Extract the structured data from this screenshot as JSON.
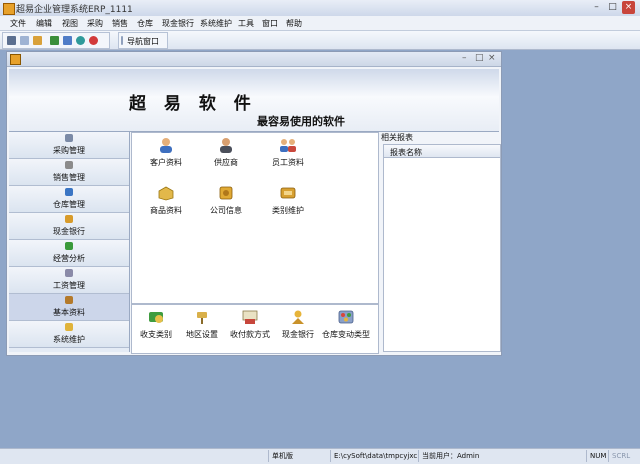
{
  "window": {
    "title": "超易企业管理系统ERP_1111"
  },
  "menu": [
    "文件",
    "编辑",
    "视图",
    "采购",
    "销售",
    "仓库",
    "现金银行",
    "系统维护",
    "工具",
    "窗口",
    "帮助"
  ],
  "toolbar": {
    "nav_window": "导航窗口"
  },
  "banner": {
    "main": "超 易 软 件",
    "sub": "最容易使用的软件"
  },
  "sidebar": {
    "items": [
      {
        "label": "采购管理",
        "icon": "purchase-icon",
        "color": "#7b8aa6"
      },
      {
        "label": "销售管理",
        "icon": "sales-icon",
        "color": "#8b8b8b"
      },
      {
        "label": "仓库管理",
        "icon": "warehouse-icon",
        "color": "#3a75c4"
      },
      {
        "label": "现金银行",
        "icon": "cash-bank-icon",
        "color": "#d89b2a"
      },
      {
        "label": "经营分析",
        "icon": "analysis-icon",
        "color": "#3a9a3a"
      },
      {
        "label": "工资管理",
        "icon": "salary-icon",
        "color": "#8a8aa8"
      },
      {
        "label": "基本资料",
        "icon": "basic-data-icon",
        "color": "#b47a2a"
      },
      {
        "label": "系统维护",
        "icon": "system-maintenance-icon",
        "color": "#e0b33a"
      }
    ],
    "active_index": 6
  },
  "content": {
    "top_icons": [
      {
        "label": "客户资料",
        "icon": "customer-icon"
      },
      {
        "label": "供应商",
        "icon": "supplier-icon"
      },
      {
        "label": "员工资料",
        "icon": "employee-icon"
      },
      {
        "label": "商品资料",
        "icon": "product-icon"
      },
      {
        "label": "公司信息",
        "icon": "company-info-icon"
      },
      {
        "label": "类别维护",
        "icon": "category-icon"
      }
    ],
    "bottom_icons": [
      {
        "label": "收支类别",
        "icon": "income-expense-icon"
      },
      {
        "label": "地区设置",
        "icon": "region-icon"
      },
      {
        "label": "收付款方式",
        "icon": "payment-method-icon"
      },
      {
        "label": "现金银行",
        "icon": "cash-bank-icon"
      },
      {
        "label": "仓库变动类型",
        "icon": "warehouse-change-icon"
      }
    ]
  },
  "right_panel": {
    "title": "相关报表",
    "column": "报表名称"
  },
  "statusbar": {
    "machine": "单机版",
    "path": "E:\\cySoft\\data\\tmpcyjxc.sys",
    "user": "当前用户：Admin",
    "num": "NUM",
    "scrl": "SCRL"
  }
}
